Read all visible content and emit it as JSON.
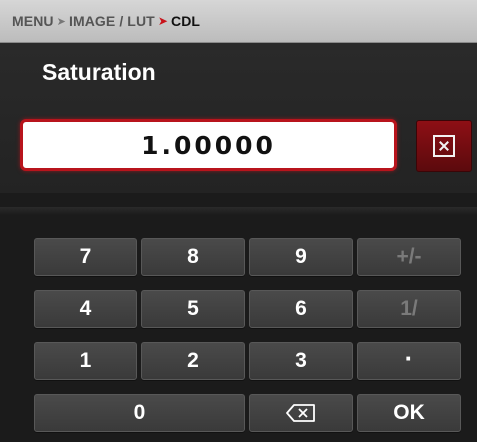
{
  "breadcrumb": {
    "items": [
      "MENU",
      "IMAGE / LUT",
      "CDL"
    ],
    "separator": ">",
    "current_color": "#c8121a"
  },
  "header": {
    "title": "Saturation"
  },
  "input": {
    "value": "1.00000"
  },
  "clear_button": {
    "icon": "clear-x-icon"
  },
  "keypad": {
    "keys": {
      "k7": "7",
      "k8": "8",
      "k9": "9",
      "plusminus": "+/-",
      "k4": "4",
      "k5": "5",
      "k6": "6",
      "reciprocal": "1/",
      "k1": "1",
      "k2": "2",
      "k3": "3",
      "decimal": "·",
      "k0": "0",
      "ok": "OK"
    },
    "backspace_icon": "backspace-icon",
    "disabled_keys": [
      "+/-",
      "1/"
    ]
  },
  "colors": {
    "accent_red": "#b8141c",
    "background": "#1b1b1b",
    "key_face": "#444444"
  }
}
